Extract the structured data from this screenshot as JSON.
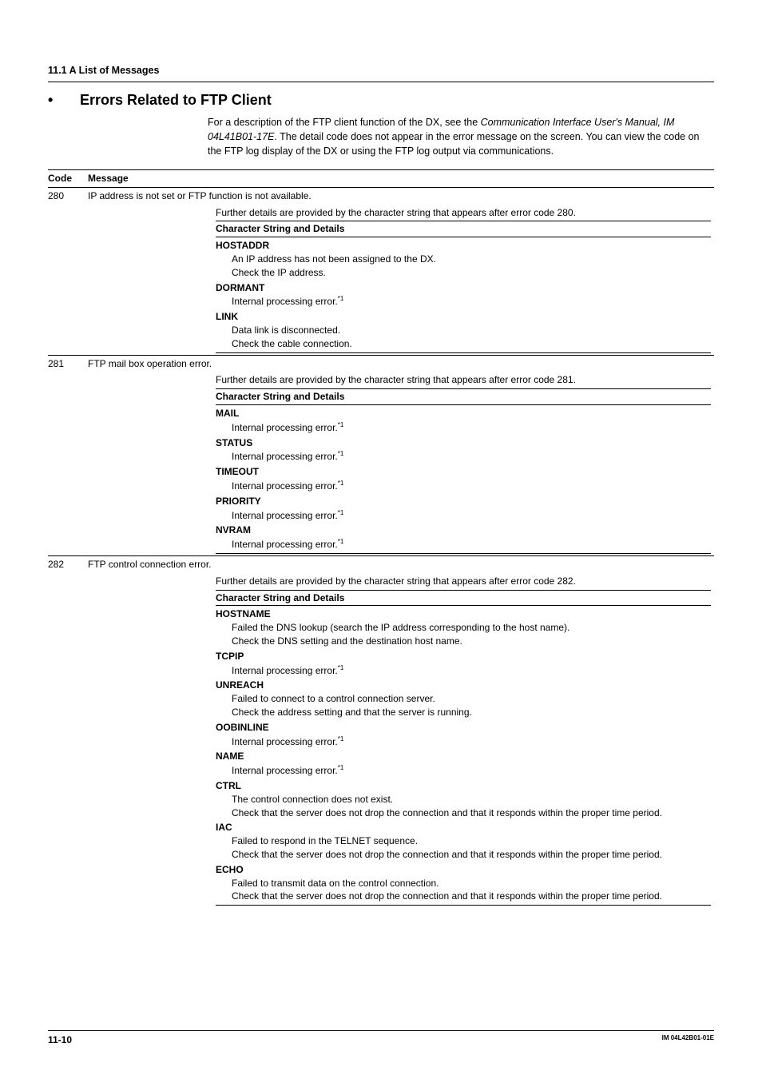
{
  "header": {
    "section": "11.1  A List of Messages"
  },
  "title": {
    "bullet": "•",
    "heading": "Errors Related to FTP Client",
    "intro_prefix": "For a description of the FTP client function of the DX, see the ",
    "intro_italic": "Communication Interface User's Manual, IM 04L41B01-17E",
    "intro_suffix": ". The detail code does not appear in the error message on the screen. You can view the code on the FTP log display of the DX or using the FTP log output via communications."
  },
  "table": {
    "head_code": "Code",
    "head_msg": "Message",
    "detail_header": "Character String and Details",
    "rows": [
      {
        "code": "280",
        "message": "IP address is not set or FTP function is not available.",
        "detail_intro": "Further details are provided by the character string that appears after error code 280.",
        "items": [
          {
            "cs": "HOSTADDR",
            "lines": [
              "An IP address has not been assigned to the DX.",
              "Check the IP address."
            ]
          },
          {
            "cs": "DORMANT",
            "lines_sup": [
              "Internal processing error."
            ]
          },
          {
            "cs": "LINK",
            "lines": [
              "Data link is disconnected.",
              "Check the cable connection."
            ]
          }
        ]
      },
      {
        "code": "281",
        "message": "FTP mail box operation error.",
        "detail_intro": "Further details are provided by the character string that appears after error code 281.",
        "items": [
          {
            "cs": "MAIL",
            "lines_sup": [
              "Internal processing error."
            ]
          },
          {
            "cs": "STATUS",
            "lines_sup": [
              "Internal processing error."
            ]
          },
          {
            "cs": "TIMEOUT",
            "lines_sup": [
              "Internal processing error."
            ]
          },
          {
            "cs": "PRIORITY",
            "lines_sup": [
              "Internal processing error."
            ]
          },
          {
            "cs": "NVRAM",
            "lines_sup": [
              "Internal processing error."
            ]
          }
        ]
      },
      {
        "code": "282",
        "message": "FTP control connection error.",
        "detail_intro": "Further details are provided by the character string that appears after error code 282.",
        "items": [
          {
            "cs": "HOSTNAME",
            "lines": [
              "Failed the DNS lookup (search the IP address corresponding to the host name).",
              "Check the DNS setting and the destination host name."
            ]
          },
          {
            "cs": "TCPIP",
            "lines_sup": [
              "Internal processing error."
            ]
          },
          {
            "cs": "UNREACH",
            "lines": [
              "Failed to connect to a control connection server.",
              "Check the address setting and that the server is running."
            ]
          },
          {
            "cs": "OOBINLINE",
            "lines_sup": [
              "Internal processing error."
            ]
          },
          {
            "cs": "NAME",
            "lines_sup": [
              "Internal processing error."
            ]
          },
          {
            "cs": "CTRL",
            "lines": [
              "The control connection does not exist.",
              "Check that the server does not drop the connection and that it responds within the proper time period."
            ]
          },
          {
            "cs": "IAC",
            "lines": [
              "Failed to respond in the TELNET sequence.",
              "Check that the server does not drop the connection and that it responds within the proper time period."
            ]
          },
          {
            "cs": "ECHO",
            "lines": [
              "Failed to transmit data on the control connection.",
              "Check that the server does not drop the connection and that it responds within the proper time period."
            ]
          }
        ]
      }
    ]
  },
  "sup_mark": "*1",
  "footer": {
    "page": "11-10",
    "doc": "IM 04L42B01-01E"
  }
}
